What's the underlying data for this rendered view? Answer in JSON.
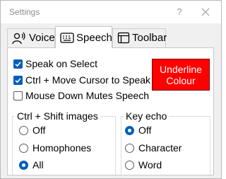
{
  "window": {
    "title": "Settings",
    "help": "?"
  },
  "tabs": [
    {
      "label": "Voice",
      "icon": "person-speaking-icon",
      "active": false
    },
    {
      "label": "Speech",
      "icon": "keyboard-speech-icon",
      "active": true
    },
    {
      "label": "Toolbar",
      "icon": "window-icon",
      "active": false
    }
  ],
  "speech": {
    "options": [
      {
        "label": "Speak on Select",
        "checked": true
      },
      {
        "label": "Ctrl + Move Cursor to Speak",
        "checked": true
      },
      {
        "label": "Mouse Down Mutes Speech",
        "checked": false
      }
    ],
    "underline_button": {
      "line1": "Underline",
      "line2": "Colour",
      "color": "#ff0000"
    },
    "ctrl_shift_images": {
      "title": "Ctrl + Shift images",
      "options": [
        {
          "label": "Off",
          "selected": false
        },
        {
          "label": "Homophones",
          "selected": false
        },
        {
          "label": "All",
          "selected": true
        }
      ]
    },
    "key_echo": {
      "title": "Key echo",
      "options": [
        {
          "label": "Off",
          "selected": true
        },
        {
          "label": "Character",
          "selected": false
        },
        {
          "label": "Word",
          "selected": false
        }
      ]
    }
  },
  "colors": {
    "accent": "#005fb8",
    "button": "#ff0000"
  }
}
